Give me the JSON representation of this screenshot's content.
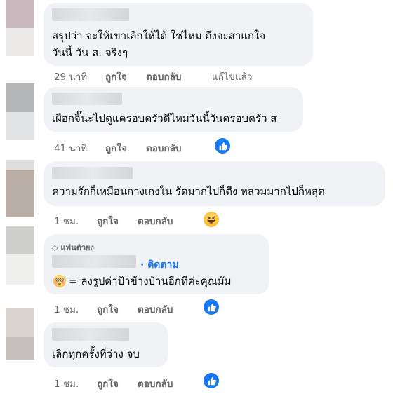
{
  "comments": [
    {
      "text_lines": [
        "สรุปว่า จะให้เขาเลิกให้ได้ ใช่ไหม ถึงจะสาแกใจ",
        "วันนี้ วัน ส. จริงๆ"
      ],
      "time": "29 นาที",
      "like_label": "ถูกใจ",
      "reply_label": "ตอบกลับ",
      "edited_label": "แก้ไขแล้ว"
    },
    {
      "text_lines": [
        "เผือกจิ๊นะไปดูแครอบครัวดีไหมวันนี้วันครอบครัว ส"
      ],
      "time": "41 นาที",
      "like_label": "ถูกใจ",
      "reply_label": "ตอบกลับ",
      "reaction": "like-icon"
    },
    {
      "text_lines": [
        "ความรักก็เหมือนกางเกงใน รัดมากไปก็ตึง หลวมมากไปก็หลุด"
      ],
      "time": "1 ชม.",
      "like_label": "ถูกใจ",
      "reply_label": "ตอบกลับ",
      "reaction": "haha-icon"
    },
    {
      "badge": "แฟนตัวยง",
      "follow_label": "· ติดตาม",
      "text_lines": [
        "= ลงรูปด่าป้าข้างบ้านอีกทีค่ะคุณมัม"
      ],
      "time": "1 ชม.",
      "like_label": "ถูกใจ",
      "reply_label": "ตอบกลับ",
      "reaction": "like-icon"
    },
    {
      "text_lines": [
        "เลิกทุกครั้งที่ว่าง จบ"
      ],
      "time": "1 ชม.",
      "like_label": "ถูกใจ",
      "reply_label": "ตอบกลับ",
      "reaction": "like-icon"
    }
  ],
  "colors": {
    "bubble": "#f0f2f5",
    "link": "#1877f2",
    "meta": "#65676b"
  }
}
